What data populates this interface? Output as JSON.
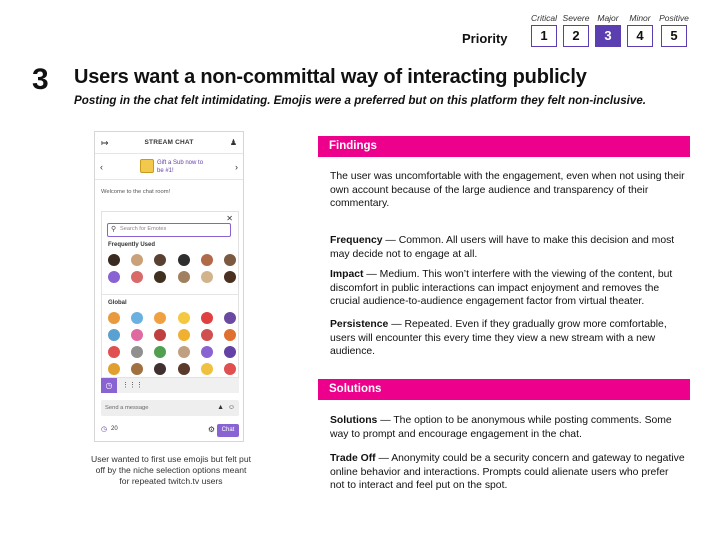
{
  "priority": {
    "label": "Priority",
    "levels": [
      {
        "name": "Critical",
        "value": "1"
      },
      {
        "name": "Severe",
        "value": "2"
      },
      {
        "name": "Major",
        "value": "3"
      },
      {
        "name": "Minor",
        "value": "4"
      },
      {
        "name": "Positive",
        "value": "5"
      }
    ],
    "selected": "3",
    "accent": "#5b3fb0"
  },
  "heading": {
    "number": "3",
    "title": "Users want a non-committal way of interacting publicly",
    "subtitle": "Posting in the chat felt intimidating. Emojis were a preferred but on this platform they felt non-inclusive."
  },
  "mockup": {
    "chat_title": "STREAM CHAT",
    "gift_text": "Gift a Sub now to be #1!",
    "welcome": "Welcome to the chat room!",
    "search_placeholder": "Search for Emotes",
    "frequently_used": "Frequently Used",
    "global": "Global",
    "send_placeholder": "Send a message",
    "points": "20",
    "chat_button": "Chat"
  },
  "caption": "User wanted to first use emojis but felt put off by the niche selection options meant for repeated twitch.tv users",
  "findings": {
    "header": "Findings",
    "intro": "The user was uncomfortable with the engagement, even when not using their own account because of the large audience and transparency of their commentary.",
    "frequency_label": "Frequency",
    "frequency_text": " — Common. All users will have to make this decision and most may decide not to engage at all.",
    "impact_label": "Impact",
    "impact_text": " — Medium. This won’t interfere with the viewing of the content, but discomfort in public interactions can impact enjoyment and removes the crucial audience-to-audience engagement factor from virtual theater.",
    "persistence_label": "Persistence",
    "persistence_text": " — Repeated. Even if they gradually grow more comfortable, users will encounter this every time they view a new stream with a new audience."
  },
  "solutions": {
    "header": "Solutions",
    "solutions_label": "Solutions",
    "solutions_text": " — The option to be anonymous while posting comments. Some way to prompt and encourage engagement in the chat.",
    "tradeoff_label": "Trade Off",
    "tradeoff_text": " — Anonymity could be a security concern and gateway to negative online behavior and interactions. Prompts could alienate users who prefer not to interact and feel put on the spot."
  },
  "colors": {
    "section_bar": "#ec008c",
    "twitch_purple": "#8a63d2"
  }
}
